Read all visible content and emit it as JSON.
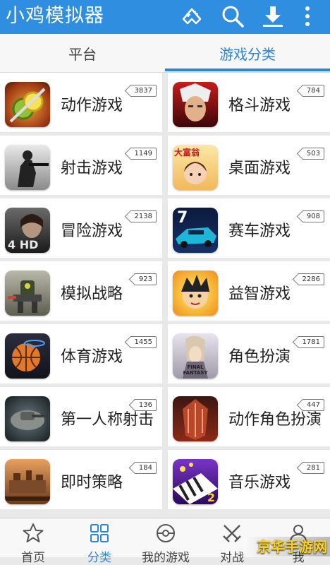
{
  "app": {
    "title": "小鸡模拟器"
  },
  "top_icons": [
    "gamepad-icon",
    "search-icon",
    "download-icon",
    "more-vertical-icon"
  ],
  "tabs": [
    {
      "label": "平台",
      "active": false
    },
    {
      "label": "游戏分类",
      "active": true
    }
  ],
  "categories": [
    {
      "label": "动作游戏",
      "count": "3837",
      "thumb": "fruit-slice"
    },
    {
      "label": "格斗游戏",
      "count": "784",
      "thumb": "fighter"
    },
    {
      "label": "射击游戏",
      "count": "1149",
      "thumb": "soldier"
    },
    {
      "label": "桌面游戏",
      "count": "503",
      "thumb": "board-game",
      "thumb_text": "大富翁"
    },
    {
      "label": "冒险游戏",
      "count": "2138",
      "thumb": "horror",
      "thumb_text": "4 HD"
    },
    {
      "label": "赛车游戏",
      "count": "908",
      "thumb": "racing",
      "thumb_text": "7"
    },
    {
      "label": "模拟战略",
      "count": "923",
      "thumb": "mech"
    },
    {
      "label": "益智游戏",
      "count": "2286",
      "thumb": "cartoon-kid"
    },
    {
      "label": "体育游戏",
      "count": "1455",
      "thumb": "basketball"
    },
    {
      "label": "角色扮演",
      "count": "1781",
      "thumb": "final-fantasy",
      "thumb_text": "FINAL FANTASY"
    },
    {
      "label": "第一人称射击",
      "count": "136",
      "thumb": "tank"
    },
    {
      "label": "动作角色扮演",
      "count": "447",
      "thumb": "armor"
    },
    {
      "label": "即时策略",
      "count": "184",
      "thumb": "strategy"
    },
    {
      "label": "音乐游戏",
      "count": "281",
      "thumb": "piano",
      "thumb_text": "2"
    }
  ],
  "bottom_nav": [
    {
      "label": "首页",
      "icon": "star-icon",
      "active": false
    },
    {
      "label": "分类",
      "icon": "grid-icon",
      "active": true
    },
    {
      "label": "我的游戏",
      "icon": "pokeball-icon",
      "active": false
    },
    {
      "label": "对战",
      "icon": "swords-icon",
      "active": false
    },
    {
      "label": "我",
      "icon": "user-icon",
      "active": false
    }
  ],
  "watermark": "京华手游网",
  "colors": {
    "primary": "#2f8ee0",
    "accent": "#2a86d6"
  }
}
